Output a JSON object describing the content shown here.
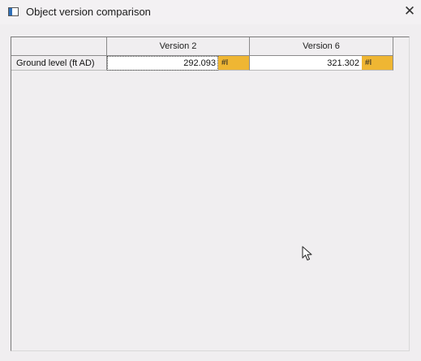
{
  "window": {
    "title": "Object version comparison",
    "close_symbol": "✕"
  },
  "grid": {
    "columns": [
      "Version 2",
      "Version 6"
    ],
    "rows": [
      {
        "label": "Ground level (ft AD)",
        "cells": [
          {
            "value": "292.093",
            "flag": "#I",
            "flag_color": "#efb633"
          },
          {
            "value": "321.302",
            "flag": "#I",
            "flag_color": "#efb633"
          }
        ]
      }
    ]
  },
  "icons": {
    "app": "window-app-icon",
    "close": "close-icon",
    "cursor": "mouse-pointer-icon"
  }
}
